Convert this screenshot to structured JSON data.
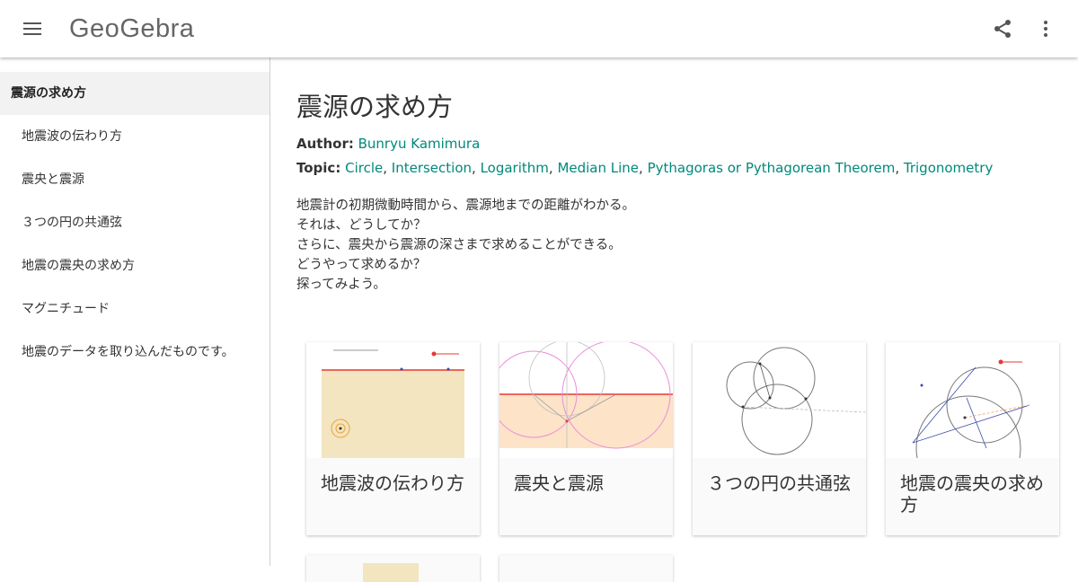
{
  "header": {
    "logo_text": "GeoGebra",
    "menu_icon": "menu-icon",
    "share_icon": "share-icon",
    "more_icon": "more-vert-icon"
  },
  "sidebar": {
    "items": [
      {
        "label": "震源の求め方",
        "active": true
      },
      {
        "label": "地震波の伝わり方"
      },
      {
        "label": "震央と震源"
      },
      {
        "label": "３つの円の共通弦"
      },
      {
        "label": "地震の震央の求め方"
      },
      {
        "label": "マグニチュード"
      },
      {
        "label": "地震のデータを取り込んだものです。"
      }
    ]
  },
  "main": {
    "title": "震源の求め方",
    "author_label": "Author:",
    "author_name": "Bunryu Kamimura",
    "topic_label": "Topic:",
    "topics": [
      "Circle",
      "Intersection",
      "Logarithm",
      "Median Line",
      "Pythagoras or Pythagorean Theorem",
      "Trigonometry"
    ],
    "description": [
      "地震計の初期微動時間から、震源地までの距離がわかる。",
      "それは、どうしてか？",
      "さらに、震央から震源の深さまで求めることができる。",
      "どうやって求めるか？",
      "探ってみよう。"
    ]
  },
  "cards": [
    {
      "title": "地震波の伝わり方"
    },
    {
      "title": "震央と震源"
    },
    {
      "title": "３つの円の共通弦"
    },
    {
      "title": "地震の震央の求め方"
    }
  ],
  "colors": {
    "link": "#00897b",
    "accent_red": "#e53935",
    "sand": "#f3e5bf",
    "peach": "#fde3c8"
  }
}
